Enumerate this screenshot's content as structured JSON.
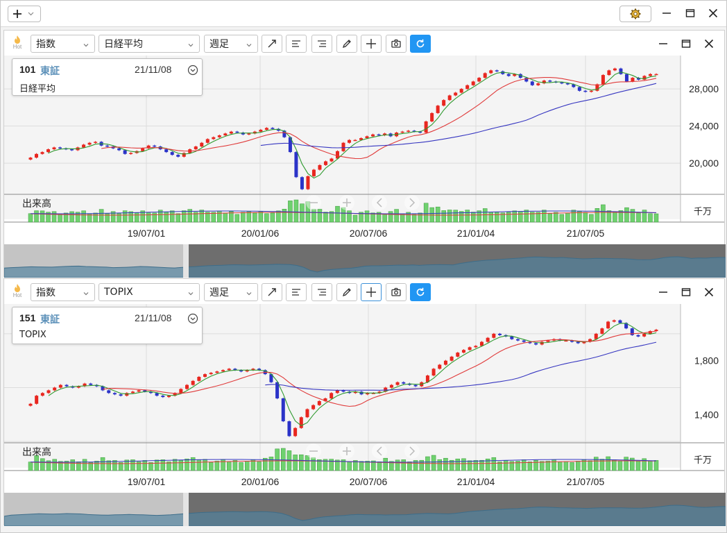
{
  "window": {
    "add_icon": "plus-icon",
    "settings_icon": "gear-icon",
    "controls": [
      "minimize-icon",
      "maximize-icon",
      "close-icon"
    ]
  },
  "toolbar_buttons": [
    "trendline-icon",
    "align-left-icon",
    "align-right-icon",
    "pencil-icon",
    "crosshair-icon",
    "camera-icon",
    "refresh-icon"
  ],
  "colors": {
    "up": "#e8261f",
    "down": "#2b33c8",
    "ma_short": "#2f9a2f",
    "ma_mid": "#e03a3a",
    "ma_long": "#3535c0",
    "volume": "#6fd16f",
    "accent": "#2196f3",
    "market_text": "#5a8fb8"
  },
  "panels": [
    {
      "hot_label": "Hot",
      "type_select": "指数",
      "symbol_select": "日経平均",
      "period_select": "週足",
      "info": {
        "code": "101",
        "market": "東証",
        "date": "21/11/08",
        "name": "日経平均"
      },
      "y_ticks": [
        "28,000",
        "24,000",
        "20,000"
      ],
      "volume_label": "出来高",
      "volume_unit": "千万",
      "x_ticks": [
        "19/07/01",
        "20/01/06",
        "20/07/06",
        "21/01/04",
        "21/07/05"
      ],
      "chart_data": {
        "type": "candlestick",
        "title": "日経平均",
        "x_tick_labels": [
          "19/07/01",
          "20/01/06",
          "20/07/06",
          "21/01/04",
          "21/07/05"
        ],
        "ylim": [
          16500,
          31000
        ],
        "y_tick_values": [
          28000,
          24000,
          20000
        ],
        "close_series": [
          20600,
          21000,
          21200,
          21500,
          21700,
          21600,
          21500,
          21400,
          21700,
          22000,
          22200,
          22300,
          21900,
          21800,
          21600,
          21400,
          21000,
          21100,
          21300,
          21600,
          21900,
          21800,
          21500,
          21200,
          20900,
          20700,
          21100,
          21500,
          21800,
          22200,
          22600,
          22800,
          23000,
          23200,
          23400,
          23300,
          23100,
          23200,
          23400,
          23600,
          23800,
          23700,
          23500,
          22800,
          21200,
          18500,
          17200,
          18600,
          19300,
          19800,
          20200,
          20500,
          21300,
          22200,
          22500,
          22500,
          22700,
          22900,
          23100,
          23000,
          23200,
          22900,
          23300,
          23400,
          23500,
          23400,
          23300,
          24500,
          25400,
          26200,
          26800,
          27300,
          27600,
          28000,
          28400,
          28800,
          29200,
          29700,
          30000,
          29900,
          29600,
          29400,
          29600,
          29200,
          28800,
          28400,
          28600,
          28900,
          28800,
          28700,
          28600,
          28500,
          28200,
          27800,
          27700,
          27800,
          28500,
          29500,
          30000,
          30200,
          29600,
          28800,
          29200,
          29000,
          29400,
          29600,
          29600
        ],
        "ma_short_label": "green",
        "ma_mid_label": "red",
        "ma_long_label": "blue"
      }
    },
    {
      "hot_label": "Hot",
      "type_select": "指数",
      "symbol_select": "TOPIX",
      "period_select": "週足",
      "info": {
        "code": "151",
        "market": "東証",
        "date": "21/11/08",
        "name": "TOPIX"
      },
      "y_ticks": [
        "1,800",
        "1,400"
      ],
      "volume_label": "出来高",
      "volume_unit": "千万",
      "x_ticks": [
        "19/07/01",
        "20/01/06",
        "20/07/06",
        "21/01/04",
        "21/07/05"
      ],
      "chart_data": {
        "type": "candlestick",
        "title": "TOPIX",
        "x_tick_labels": [
          "19/07/01",
          "20/01/06",
          "20/07/06",
          "21/01/04",
          "21/07/05"
        ],
        "ylim": [
          1180,
          2180
        ],
        "y_tick_values": [
          1800,
          1400
        ],
        "close_series": [
          1480,
          1540,
          1560,
          1580,
          1600,
          1620,
          1610,
          1600,
          1610,
          1630,
          1620,
          1610,
          1580,
          1560,
          1550,
          1540,
          1560,
          1570,
          1580,
          1570,
          1560,
          1540,
          1530,
          1540,
          1560,
          1590,
          1620,
          1650,
          1680,
          1700,
          1710,
          1720,
          1730,
          1740,
          1730,
          1720,
          1730,
          1740,
          1730,
          1700,
          1640,
          1520,
          1350,
          1240,
          1300,
          1380,
          1440,
          1470,
          1500,
          1520,
          1560,
          1580,
          1570,
          1560,
          1570,
          1550,
          1560,
          1560,
          1570,
          1600,
          1620,
          1640,
          1630,
          1620,
          1610,
          1640,
          1690,
          1740,
          1770,
          1800,
          1830,
          1860,
          1880,
          1900,
          1910,
          1940,
          1970,
          2000,
          1990,
          1980,
          1960,
          1950,
          1940,
          1930,
          1920,
          1940,
          1950,
          1960,
          1950,
          1950,
          1940,
          1930,
          1940,
          1960,
          2000,
          2040,
          2090,
          2100,
          2080,
          2040,
          1990,
          1980,
          2000,
          2020,
          2030
        ],
        "ma_short_label": "green",
        "ma_mid_label": "red",
        "ma_long_label": "blue"
      }
    }
  ]
}
